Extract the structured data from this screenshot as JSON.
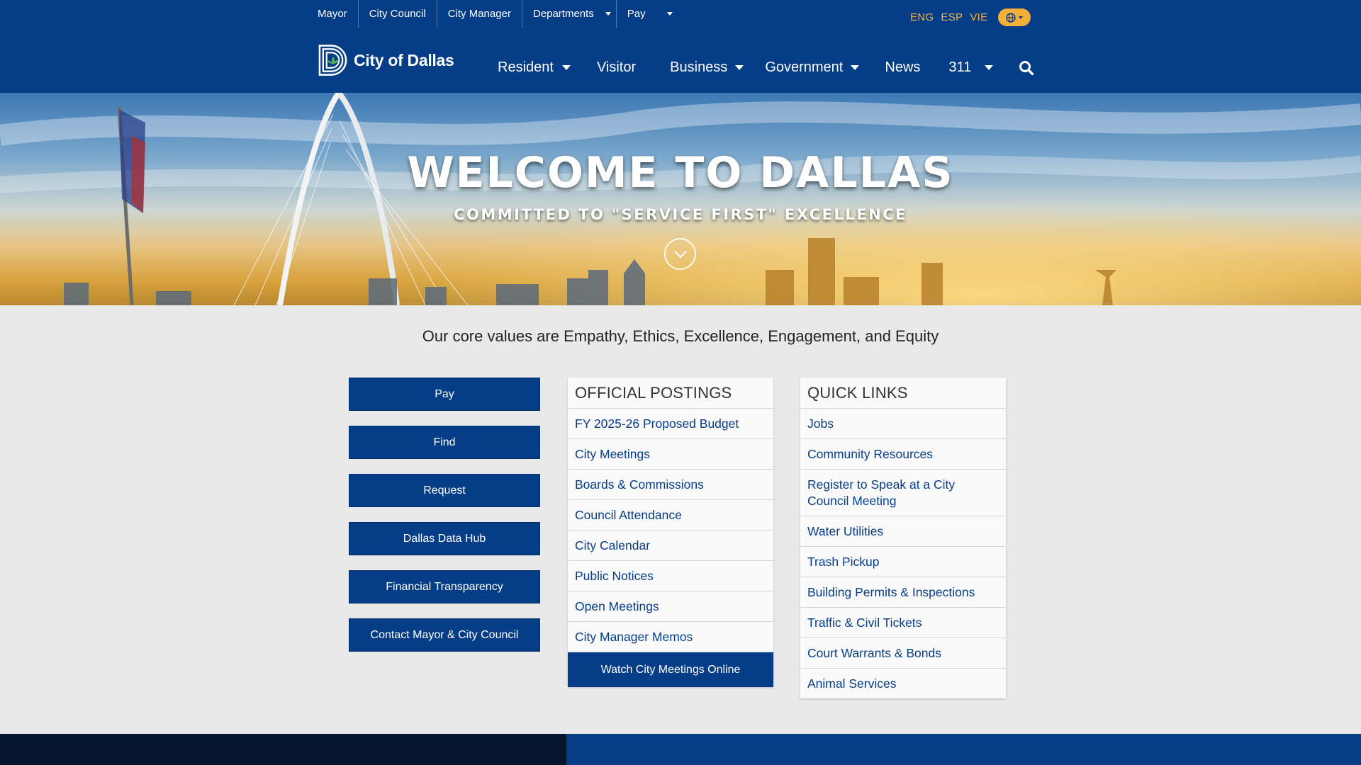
{
  "utility_nav": {
    "items": [
      "Mayor",
      "City Council",
      "City Manager",
      "Departments",
      "Pay"
    ]
  },
  "languages": [
    "ENG",
    "ESP",
    "VIE"
  ],
  "logo": {
    "text": "City of Dallas"
  },
  "main_nav": {
    "items": [
      "Resident",
      "Visitor",
      "Business",
      "Government",
      "News",
      "311"
    ]
  },
  "hero": {
    "title": "WELCOME TO DALLAS",
    "subtitle": "COMMITTED TO \"SERVICE FIRST\" EXCELLENCE"
  },
  "core_values": "Our core values are Empathy, Ethics, Excellence, Engagement, and Equity",
  "action_buttons": [
    "Pay",
    "Find",
    "Request",
    "Dallas Data Hub",
    "Financial Transparency",
    "Contact Mayor & City Council"
  ],
  "official_postings": {
    "title": "OFFICIAL POSTINGS",
    "links": [
      "FY 2025-26 Proposed Budget",
      "City Meetings",
      "Boards & Commissions",
      "Council Attendance",
      "City Calendar",
      "Public Notices",
      "Open Meetings",
      "City Manager Memos"
    ],
    "watch_button": "Watch City Meetings Online"
  },
  "quick_links": {
    "title": "QUICK LINKS",
    "links": [
      "Jobs",
      "Community Resources",
      "Register to Speak at a City Council Meeting",
      "Water Utilities",
      "Trash Pickup",
      "Building Permits & Inspections",
      "Traffic & Civil Tickets",
      "Court Warrants & Bonds",
      "Animal Services"
    ]
  },
  "colors": {
    "brand_blue": "#063d87",
    "accent_gold": "#f4b03b",
    "page_bg": "#e9e9e9",
    "footer_dark": "#06152e"
  }
}
